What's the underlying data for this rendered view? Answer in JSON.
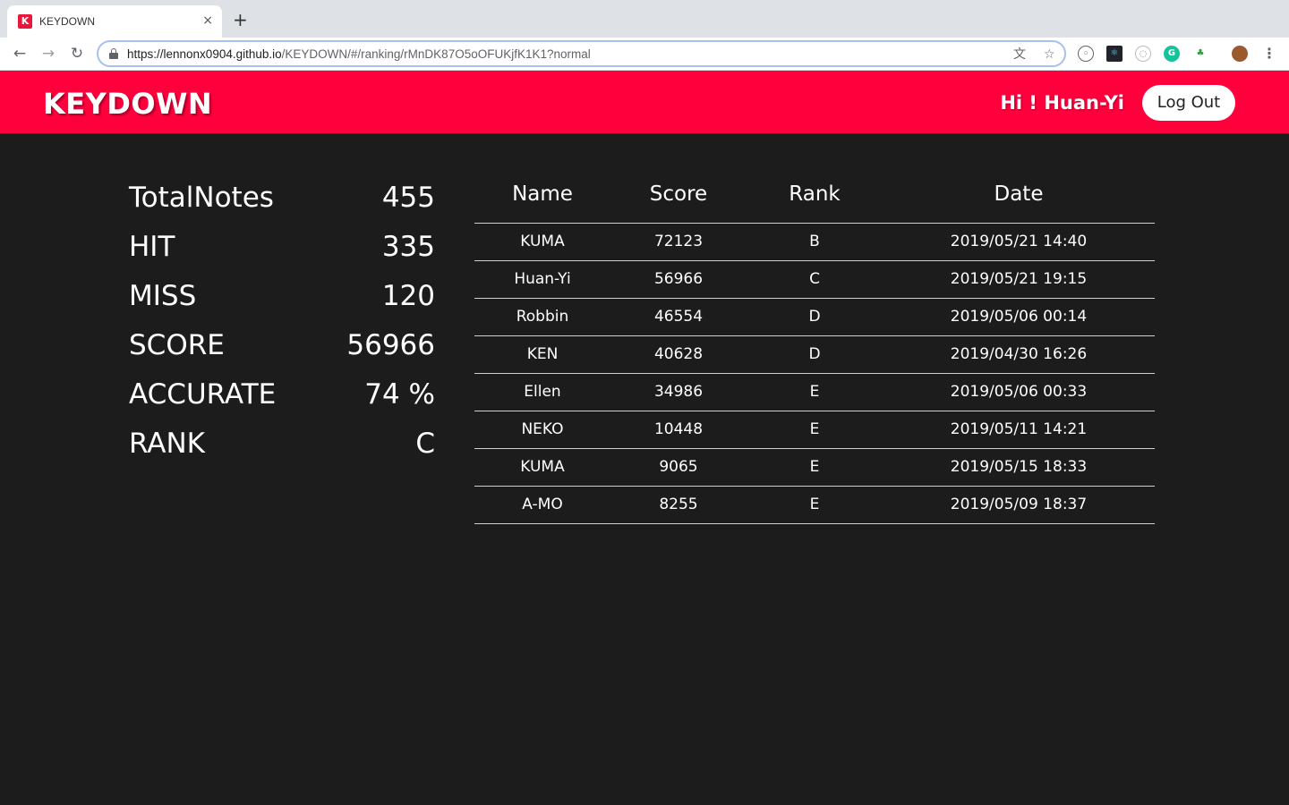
{
  "browser": {
    "tab_title": "KEYDOWN",
    "tab_favicon_letter": "K",
    "tab_close": "×",
    "new_tab": "+",
    "url_host": "https://lennonx0904.github.io",
    "url_path": "/KEYDOWN/#/ranking/rMnDK87O5oOFUKjfK1K1?normal"
  },
  "header": {
    "brand": "KEYDOWN",
    "greeting": "Hi ! Huan-Yi",
    "logout_label": "Log Out",
    "accent_color": "#ff003c"
  },
  "stats": [
    {
      "label": "TotalNotes",
      "value": "455"
    },
    {
      "label": "HIT",
      "value": "335"
    },
    {
      "label": "MISS",
      "value": "120"
    },
    {
      "label": "SCORE",
      "value": "56966"
    },
    {
      "label": "ACCURATE",
      "value": "74 %"
    },
    {
      "label": "RANK",
      "value": "C"
    }
  ],
  "ranking": {
    "columns": [
      "Name",
      "Score",
      "Rank",
      "Date"
    ],
    "rows": [
      [
        "KUMA",
        "72123",
        "B",
        "2019/05/21 14:40"
      ],
      [
        "Huan-Yi",
        "56966",
        "C",
        "2019/05/21 19:15"
      ],
      [
        "Robbin",
        "46554",
        "D",
        "2019/05/06 00:14"
      ],
      [
        "KEN",
        "40628",
        "D",
        "2019/04/30 16:26"
      ],
      [
        "Ellen",
        "34986",
        "E",
        "2019/05/06 00:33"
      ],
      [
        "NEKO",
        "10448",
        "E",
        "2019/05/11 14:21"
      ],
      [
        "KUMA",
        "9065",
        "E",
        "2019/05/15 18:33"
      ],
      [
        "A-MO",
        "8255",
        "E",
        "2019/05/09 18:37"
      ]
    ]
  }
}
